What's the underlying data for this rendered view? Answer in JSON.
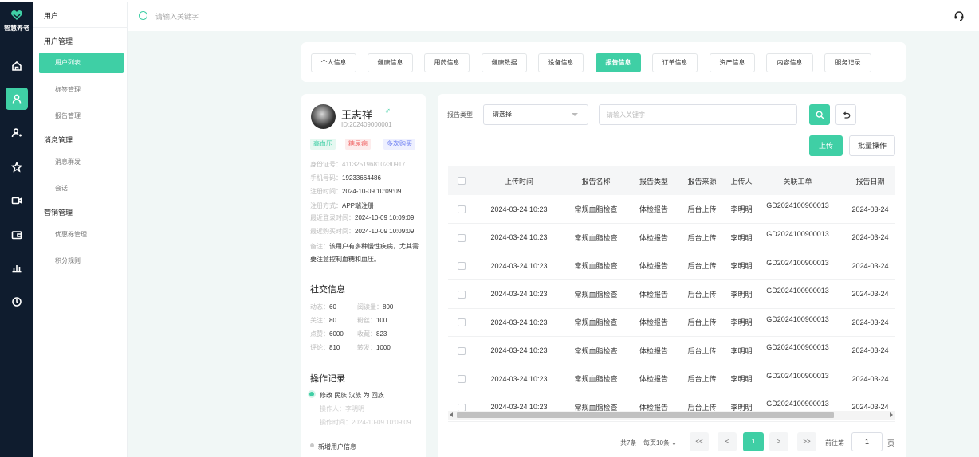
{
  "app": {
    "logo_text": "智慧养老",
    "accent": "#3fcfa5",
    "rail_bg": "#0f1c2e"
  },
  "rail": {
    "items": [
      {
        "icon": "home-icon",
        "active": false
      },
      {
        "icon": "user-icon",
        "active": true
      },
      {
        "icon": "user-settings-icon",
        "active": false
      },
      {
        "icon": "star-icon",
        "active": false
      },
      {
        "icon": "video-icon",
        "active": false
      },
      {
        "icon": "wallet-icon",
        "active": false
      },
      {
        "icon": "bar-chart-icon",
        "active": false
      },
      {
        "icon": "clock-icon",
        "active": false
      }
    ]
  },
  "sidebar": {
    "title": "用户",
    "groups": [
      {
        "label": "用户管理",
        "items": [
          {
            "label": "用户列表",
            "active": true
          },
          {
            "label": "标签管理"
          },
          {
            "label": "报告管理"
          }
        ]
      },
      {
        "label": "消息管理",
        "items": [
          {
            "label": "消息群发"
          },
          {
            "label": "会话"
          }
        ]
      },
      {
        "label": "营销管理",
        "items": [
          {
            "label": "优惠券管理"
          },
          {
            "label": "积分规则"
          }
        ]
      }
    ]
  },
  "topbar": {
    "search_placeholder": "请输入关键字",
    "headset_icon": "headset-icon"
  },
  "tabs": [
    {
      "label": "个人信息",
      "active": false
    },
    {
      "label": "健康信息",
      "active": false
    },
    {
      "label": "用药信息",
      "active": false
    },
    {
      "label": "健康数据",
      "active": false
    },
    {
      "label": "设备信息",
      "active": false
    },
    {
      "label": "报告信息",
      "active": true
    },
    {
      "label": "订单信息",
      "active": false
    },
    {
      "label": "资产信息",
      "active": false
    },
    {
      "label": "内容信息",
      "active": false
    },
    {
      "label": "服务记录",
      "active": false
    }
  ],
  "profile": {
    "name": "王志祥",
    "gender": "♂",
    "id": "ID:202409000001",
    "tags": [
      "高血压",
      "糖尿病",
      "多次购买"
    ],
    "info": [
      {
        "key": "身份证号：",
        "value": "411325196810230917"
      },
      {
        "key": "手机号码：",
        "value": "19233664486"
      },
      {
        "key": "注册时间：",
        "value": "2024-10-09 10:09:09"
      },
      {
        "key": "注册方式：",
        "value": "APP端注册"
      },
      {
        "key": "最近登录时间：",
        "value": "2024-10-09 10:09:09"
      },
      {
        "key": "最近购买时间：",
        "value": "2024-10-09 10:09:09"
      }
    ],
    "note_key": "备注：",
    "note_value": "该用户有多种慢性疾病，尤其需要注意控制血糖和血压。",
    "social_title": "社交信息",
    "social": [
      {
        "key": "动态：",
        "value": "60"
      },
      {
        "key": "阅读量：",
        "value": "800"
      },
      {
        "key": "关注：",
        "value": "80"
      },
      {
        "key": "粉丝：",
        "value": "100"
      },
      {
        "key": "点赞：",
        "value": "6000"
      },
      {
        "key": "收藏：",
        "value": "823"
      },
      {
        "key": "评论：",
        "value": "810"
      },
      {
        "key": "转发：",
        "value": "1000"
      }
    ],
    "ops_title": "操作记录",
    "ops": [
      {
        "action": "修改 民族 汉族 为 回族",
        "operator_key": "操作人：",
        "operator": "李明明",
        "time_key": "操作时间：",
        "time": "2024-10-09 10:09:09"
      },
      {
        "action": "新增用户信息"
      }
    ]
  },
  "filters": {
    "type_label": "报告类型",
    "select_value": "请选择",
    "keyword_placeholder": "请输入关键字",
    "upload_label": "上传",
    "batch_label": "批量操作"
  },
  "table": {
    "columns": [
      "上传时间",
      "报告名称",
      "报告类型",
      "报告来源",
      "上传人",
      "关联工单",
      "报告日期"
    ],
    "rows": [
      [
        "2024-03-24 10:23",
        "常规血脂检查",
        "体检报告",
        "后台上传",
        "李明明",
        "GD2024100900013",
        "2024-03-24"
      ],
      [
        "2024-03-24 10:23",
        "常规血脂检查",
        "体检报告",
        "后台上传",
        "李明明",
        "GD2024100900013",
        "2024-03-24"
      ],
      [
        "2024-03-24 10:23",
        "常规血脂检查",
        "体检报告",
        "后台上传",
        "李明明",
        "GD2024100900013",
        "2024-03-24"
      ],
      [
        "2024-03-24 10:23",
        "常规血脂检查",
        "体检报告",
        "后台上传",
        "李明明",
        "GD2024100900013",
        "2024-03-24"
      ],
      [
        "2024-03-24 10:23",
        "常规血脂检查",
        "体检报告",
        "后台上传",
        "李明明",
        "GD2024100900013",
        "2024-03-24"
      ],
      [
        "2024-03-24 10:23",
        "常规血脂检查",
        "体检报告",
        "后台上传",
        "李明明",
        "GD2024100900013",
        "2024-03-24"
      ],
      [
        "2024-03-24 10:23",
        "常规血脂检查",
        "体检报告",
        "后台上传",
        "李明明",
        "GD2024100900013",
        "2024-03-24"
      ],
      [
        "2024-03-24 10:23",
        "常规血脂检查",
        "体检报告",
        "后台上传",
        "李明明",
        "GD2024100900013",
        "2024-03-24"
      ]
    ]
  },
  "pagination": {
    "total": "共7条",
    "page_size": "每页10条",
    "first": "<<",
    "prev": "<",
    "current": "1",
    "next": ">",
    "last": ">>",
    "goto_label": "前往第",
    "goto_value": "1",
    "unit": "页"
  }
}
